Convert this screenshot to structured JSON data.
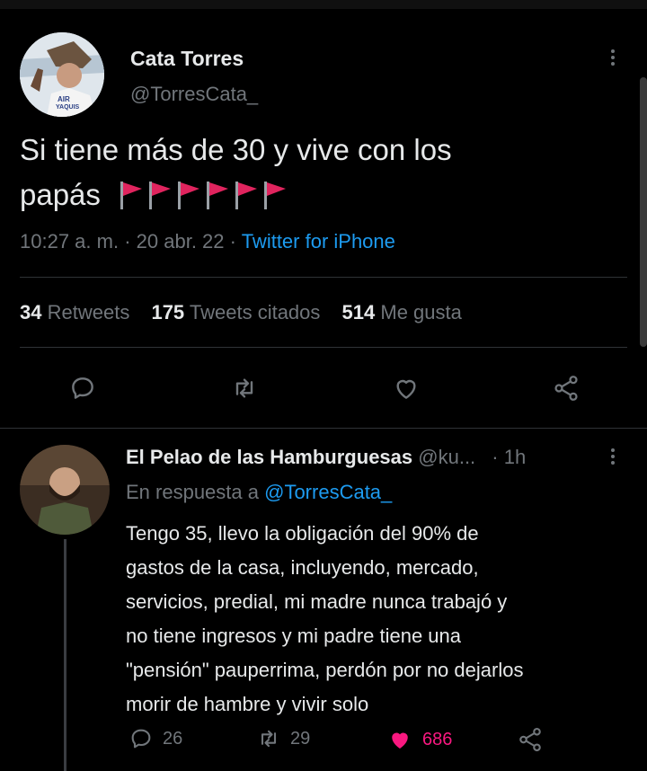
{
  "tweet": {
    "display_name": "Cata Torres",
    "handle": "@TorresCata_",
    "text": "Si tiene más de 30 y vive con los",
    "text_line2": "papás",
    "flag_count": 6,
    "time": "10:27 a. m.",
    "sep1": "·",
    "date": "20 abr. 22",
    "sep2": "·",
    "source": "Twitter for iPhone",
    "stats": {
      "retweets_count": "34",
      "retweets_label": "Retweets",
      "quotes_count": "175",
      "quotes_label": "Tweets citados",
      "likes_count": "514",
      "likes_label": "Me gusta"
    },
    "avatar_text_1": "AIR",
    "avatar_text_2": "YAQUIS"
  },
  "reply": {
    "display_name": "El Pelao de las Hamburguesas",
    "handle": "@ku...",
    "time": "· 1h",
    "in_reply_prefix": "En respuesta a",
    "in_reply_handle": "@TorresCata_",
    "lines": [
      "Tengo 35, llevo la obligación del 90% de",
      "gastos de la casa, incluyendo, mercado,",
      "servicios, predial, mi madre nunca trabajó y",
      "no tiene ingresos y mi padre tiene una",
      "\"pensión\" pauperrima, perdón por no dejarlos",
      "morir de hambre y vivir solo"
    ],
    "reply_count": "26",
    "retweet_count": "29",
    "like_count": "686"
  },
  "colors": {
    "background": "#000000",
    "text": "#e7e9ea",
    "muted": "#71767b",
    "link": "#1d9bf0",
    "like": "#f91880",
    "flag": "#e0245e"
  },
  "icons": {
    "reply": "reply-icon",
    "retweet": "retweet-icon",
    "like": "heart-icon",
    "share": "share-icon",
    "more": "more-icon",
    "flag": "red-flag-icon"
  }
}
